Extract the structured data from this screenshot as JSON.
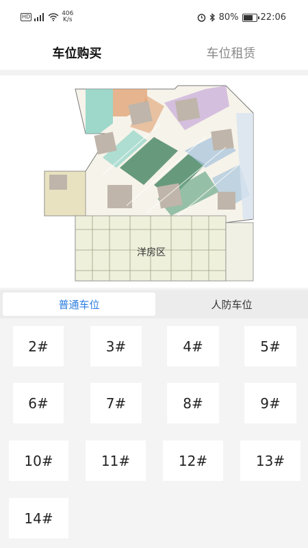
{
  "status_bar": {
    "hd": "HD",
    "net_speed": "406",
    "net_unit": "K/s",
    "battery": "80%",
    "battery_level": 0.8,
    "time": "22:06"
  },
  "tabs": [
    {
      "label": "车位购买",
      "active": true
    },
    {
      "label": "车位租赁",
      "active": false
    }
  ],
  "map": {
    "area_label": "洋房区"
  },
  "segment": [
    {
      "label": "普通车位",
      "active": true
    },
    {
      "label": "人防车位",
      "active": false
    }
  ],
  "spots": [
    "2#",
    "3#",
    "4#",
    "5#",
    "6#",
    "7#",
    "8#",
    "9#",
    "10#",
    "11#",
    "12#",
    "13#",
    "14#"
  ],
  "colors": {
    "accent": "#2b7de0",
    "zone_green": "#4e8a6a",
    "zone_teal": "#7fcfbf",
    "zone_orange": "#e0a070",
    "zone_purple": "#c8a8d8",
    "zone_blue": "#a8c4dc",
    "zone_cream": "#e8e2c0",
    "building": "#bfb5aa"
  }
}
